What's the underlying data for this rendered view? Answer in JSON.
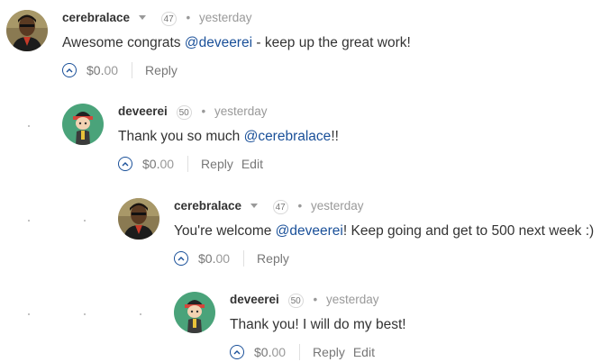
{
  "comments": [
    {
      "author": "cerebralace",
      "reputation": "47",
      "time": "yesterday",
      "text_pre": "Awesome congrats ",
      "mention": "@deveerei",
      "text_post": " - keep up the great work!",
      "payout_dollars": "$0.",
      "payout_cents": "00",
      "reply_label": "Reply"
    },
    {
      "author": "deveerei",
      "reputation": "50",
      "time": "yesterday",
      "text_pre": "Thank you so much ",
      "mention": "@cerebralace",
      "text_post": "!!",
      "payout_dollars": "$0.",
      "payout_cents": "00",
      "reply_label": "Reply",
      "edit_label": "Edit"
    },
    {
      "author": "cerebralace",
      "reputation": "47",
      "time": "yesterday",
      "text_pre": "You're welcome ",
      "mention": "@deveerei",
      "text_post": "! Keep going and get to 500 next week :)",
      "payout_dollars": "$0.",
      "payout_cents": "00",
      "reply_label": "Reply"
    },
    {
      "author": "deveerei",
      "reputation": "50",
      "time": "yesterday",
      "text": "Thank you! I will do my best!",
      "payout_dollars": "$0.",
      "payout_cents": "00",
      "reply_label": "Reply",
      "edit_label": "Edit"
    }
  ],
  "colors": {
    "mention": "#1a5099",
    "vote_button": "#1a5099",
    "avatar_deveerei_bg": "#4aa37a"
  },
  "icons": {
    "vote": "upvote-chevron-icon",
    "author_menu": "caret-down-icon"
  }
}
